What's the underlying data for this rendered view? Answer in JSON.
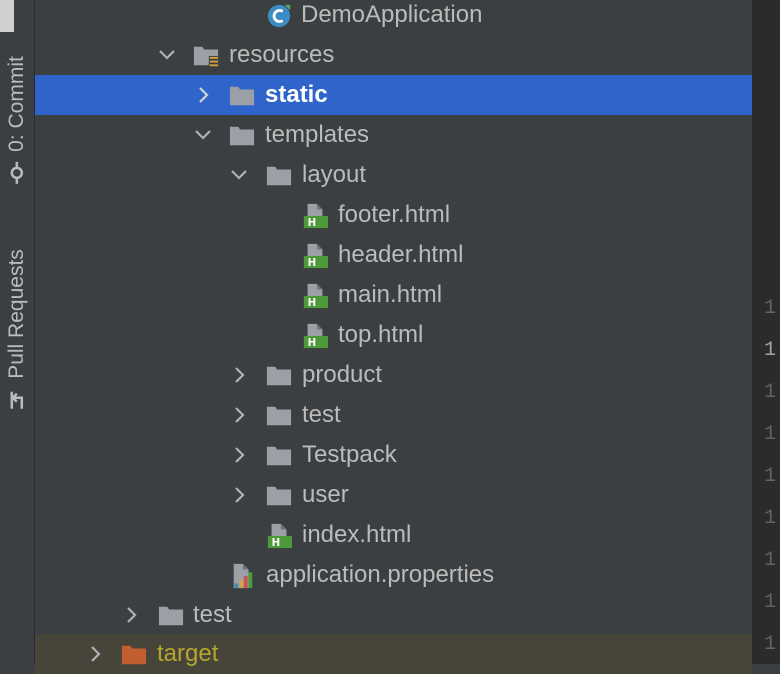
{
  "side_tabs": {
    "commit_label": "0: Commit",
    "pull_requests_label": "Pull Requests"
  },
  "tree": {
    "items": [
      {
        "label": "DemoApplication",
        "type": "java-class",
        "expanded": null
      },
      {
        "label": "resources",
        "type": "resources-folder",
        "expanded": true
      },
      {
        "label": "static",
        "type": "folder",
        "expanded": false,
        "selected": true
      },
      {
        "label": "templates",
        "type": "folder",
        "expanded": true
      },
      {
        "label": "layout",
        "type": "folder",
        "expanded": true
      },
      {
        "label": "footer.html",
        "type": "html-file",
        "expanded": null
      },
      {
        "label": "header.html",
        "type": "html-file",
        "expanded": null
      },
      {
        "label": "main.html",
        "type": "html-file",
        "expanded": null
      },
      {
        "label": "top.html",
        "type": "html-file",
        "expanded": null
      },
      {
        "label": "product",
        "type": "folder",
        "expanded": false
      },
      {
        "label": "test",
        "type": "folder",
        "expanded": false
      },
      {
        "label": "Testpack",
        "type": "folder",
        "expanded": false
      },
      {
        "label": "user",
        "type": "folder",
        "expanded": false
      },
      {
        "label": "index.html",
        "type": "html-file",
        "expanded": null
      },
      {
        "label": "application.properties",
        "type": "properties-file",
        "expanded": null
      },
      {
        "label": "test",
        "type": "folder",
        "expanded": false
      },
      {
        "label": "target",
        "type": "excluded-folder",
        "expanded": false
      }
    ]
  },
  "gutter": {
    "numbers": [
      "1",
      "1",
      "1",
      "1",
      "1",
      "1",
      "1",
      "1",
      "1"
    ]
  },
  "colors": {
    "selection": "#2f65ca",
    "target_text": "#b5a72d",
    "html_icon_green": "#4d9a3a",
    "folder_gray": "#9aa0a6"
  }
}
